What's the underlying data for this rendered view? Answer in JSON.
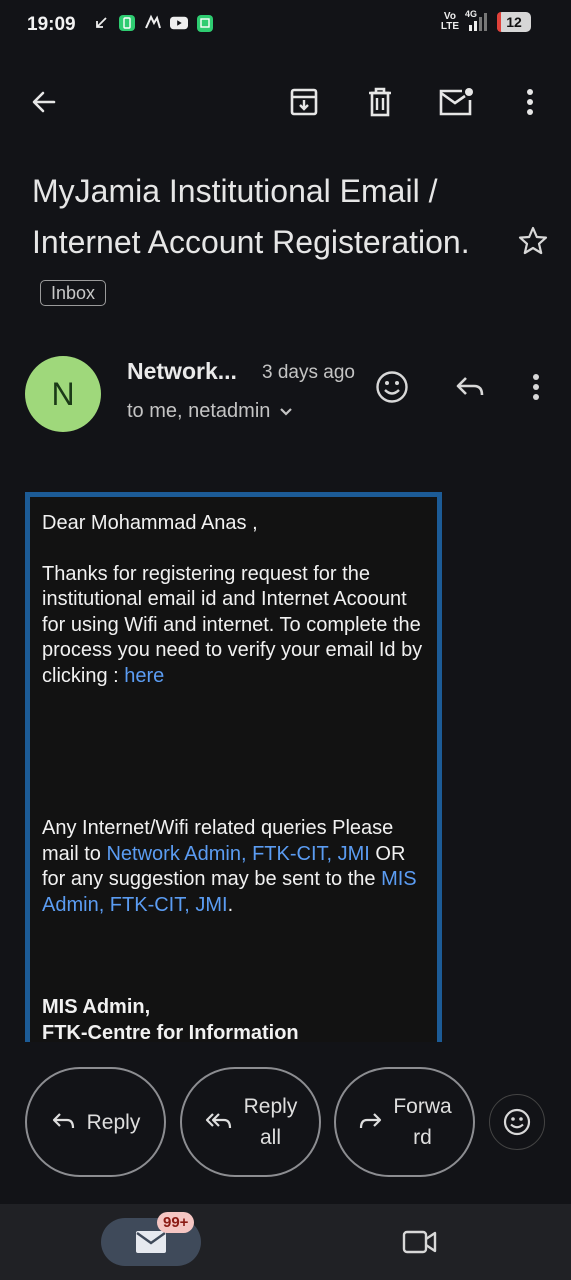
{
  "status_bar": {
    "time": "19:09",
    "network_label_top": "Vo",
    "network_label_bottom": "LTE",
    "signal_label": "4G",
    "battery_level": "12",
    "icons": [
      "missed-call-arrow-icon",
      "app-notification-icon",
      "app-notification-icon",
      "youtube-icon",
      "app-notification-icon"
    ]
  },
  "toolbar": {
    "back": "arrow-left-icon",
    "archive": "archive-icon",
    "delete": "trash-icon",
    "mark_unread": "mail-unread-icon",
    "more": "more-vert-icon"
  },
  "email": {
    "subject": "MyJamia Institutional Email / Internet Account Registeration.",
    "label": "Inbox",
    "sender_initial": "N",
    "sender_name": "Network...",
    "time": "3 days ago",
    "recipients": "to me, netadmin",
    "avatar_color": "#9fd87b",
    "body": {
      "greeting": "Dear Mohammad Anas ,",
      "para1": "Thanks for registering request for the institutional email id and Internet Acoount for using Wifi and internet. To complete the process you need to verify your email Id by clicking : ",
      "link_here": "here",
      "para2_a": "Any Internet/Wifi related queries Please mail to ",
      "link_network_admin": "Network Admin, FTK-CIT, JMI",
      "para2_b": " OR for any suggestion may be sent to the ",
      "link_mis_admin": "MIS Admin, FTK-CIT, JMI",
      "para2_c": ".",
      "sig_line1": "MIS Admin,",
      "sig_line2": "FTK-Centre for Information"
    }
  },
  "actions": {
    "reply": "Reply",
    "reply_all_1": "Reply",
    "reply_all_2": "all",
    "forward_1": "Forwa",
    "forward_2": "rd"
  },
  "bottom_nav": {
    "mail_badge": "99+"
  },
  "colors": {
    "accent_link": "#5b9cf2",
    "card_border": "#1c5b96",
    "background": "#121317"
  }
}
